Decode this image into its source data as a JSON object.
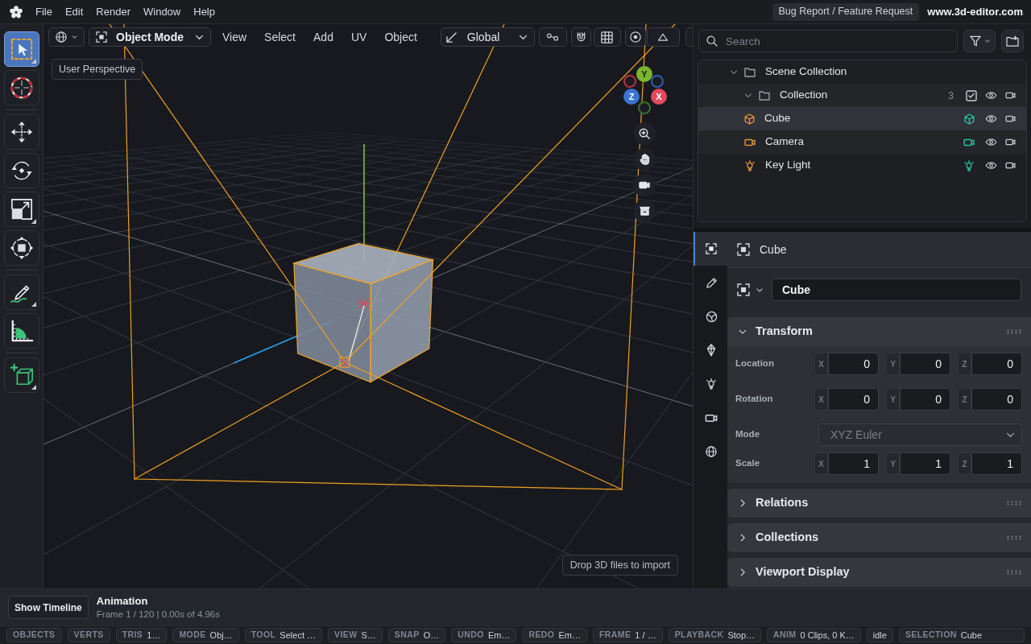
{
  "menubar": {
    "menus": [
      "File",
      "Edit",
      "Render",
      "Window",
      "Help"
    ],
    "feedback_button": "Bug Report / Feature Request",
    "site_link": "www.3d-editor.com"
  },
  "toolbar": {
    "groups": [
      {
        "tools": [
          {
            "kind": "select",
            "selected": true,
            "has_menu": true
          },
          {
            "kind": "cursor",
            "selected": false,
            "has_menu": false
          }
        ]
      },
      {
        "tools": [
          {
            "kind": "move",
            "selected": false,
            "has_menu": false
          },
          {
            "kind": "rotate",
            "selected": false,
            "has_menu": false
          },
          {
            "kind": "scale",
            "selected": false,
            "has_menu": true
          },
          {
            "kind": "transform",
            "selected": false,
            "has_menu": false
          }
        ]
      },
      {
        "tools": [
          {
            "kind": "annotate",
            "selected": false,
            "has_menu": true
          },
          {
            "kind": "measure",
            "selected": false,
            "has_menu": false
          }
        ]
      },
      {
        "tools": [
          {
            "kind": "add_cube",
            "selected": false,
            "has_menu": true
          }
        ]
      }
    ]
  },
  "viewport": {
    "header": {
      "mode_select": "Object Mode",
      "menus": [
        "View",
        "Select",
        "Add",
        "UV",
        "Object"
      ],
      "orientation_select": "Global"
    },
    "tooltip": "User Perspective",
    "gizmo": {
      "axes": [
        {
          "kind": "negative",
          "color": "#b8323f"
        },
        {
          "kind": "negative",
          "color": "#2f5fae"
        },
        {
          "kind": "negative",
          "color": "#3a6e2a"
        },
        {
          "kind": "positive",
          "label": "Y",
          "color": "#7ab530"
        },
        {
          "kind": "positive",
          "label": "Z",
          "color": "#3a73d0"
        },
        {
          "kind": "positive",
          "label": "X",
          "color": "#e04a5c"
        }
      ]
    },
    "drop_hint": "Drop 3D files to import"
  },
  "outliner": {
    "search": {
      "placeholder": "Search"
    },
    "tree": [
      {
        "kind": "scene_collection",
        "label": "Scene Collection",
        "expanded": true,
        "selected": false,
        "children": [
          {
            "kind": "collection",
            "label": "Collection",
            "count": "3",
            "checked": true,
            "expanded": true,
            "selected": false,
            "children": [
              {
                "kind": "mesh",
                "label": "Cube",
                "selected": true
              },
              {
                "kind": "camera",
                "label": "Camera",
                "selected": false
              },
              {
                "kind": "light",
                "label": "Key Light",
                "selected": false
              }
            ]
          }
        ]
      }
    ]
  },
  "properties": {
    "tabs": [
      {
        "kind": "object",
        "selected": true
      },
      {
        "kind": "modifiers",
        "selected": false
      },
      {
        "kind": "material",
        "selected": false
      },
      {
        "kind": "data",
        "selected": false
      },
      {
        "kind": "light",
        "selected": false
      },
      {
        "kind": "camera",
        "selected": false
      },
      {
        "kind": "world",
        "selected": false
      }
    ],
    "header": "Cube",
    "object_name": "Cube",
    "panels": [
      {
        "title": "Transform",
        "expanded": true,
        "rows": [
          {
            "kind": "vector",
            "label": "Location",
            "fields": [
              {
                "axis": "X",
                "value": "0"
              },
              {
                "axis": "Y",
                "value": "0"
              },
              {
                "axis": "Z",
                "value": "0"
              }
            ]
          },
          {
            "kind": "vector",
            "label": "Rotation",
            "fields": [
              {
                "axis": "X",
                "value": "0"
              },
              {
                "axis": "Y",
                "value": "0"
              },
              {
                "axis": "Z",
                "value": "0"
              }
            ]
          },
          {
            "kind": "select",
            "label": "Mode",
            "value": "XYZ Euler",
            "disabled": true
          },
          {
            "kind": "vector",
            "label": "Scale",
            "fields": [
              {
                "axis": "X",
                "value": "1"
              },
              {
                "axis": "Y",
                "value": "1"
              },
              {
                "axis": "Z",
                "value": "1"
              }
            ]
          }
        ]
      },
      {
        "title": "Relations",
        "expanded": false
      },
      {
        "title": "Collections",
        "expanded": false
      },
      {
        "title": "Viewport Display",
        "expanded": false
      }
    ]
  },
  "timeline": {
    "button": "Show Timeline",
    "title": "Animation",
    "subtitle": "Frame 1 / 120 | 0.00s of 4.96s"
  },
  "status_bar": [
    {
      "label": "OBJECTS"
    },
    {
      "label": "VERTS"
    },
    {
      "label": "TRIS",
      "value": "1…"
    },
    {
      "label": "MODE",
      "value": "Obj…"
    },
    {
      "label": "TOOL",
      "value": "Select …"
    },
    {
      "label": "VIEW",
      "value": "S…"
    },
    {
      "label": "SNAP",
      "value": "O…"
    },
    {
      "label": "UNDO",
      "value": "Em…"
    },
    {
      "label": "REDO",
      "value": "Em…"
    },
    {
      "label": "FRAME",
      "value": "1 / …"
    },
    {
      "label": "PLAYBACK",
      "value": "Stop…"
    },
    {
      "label": "ANIM",
      "value": "0 Clips, 0 K…"
    },
    {
      "value": "idle"
    },
    {
      "label": "SELECTION",
      "value": "Cube"
    }
  ]
}
